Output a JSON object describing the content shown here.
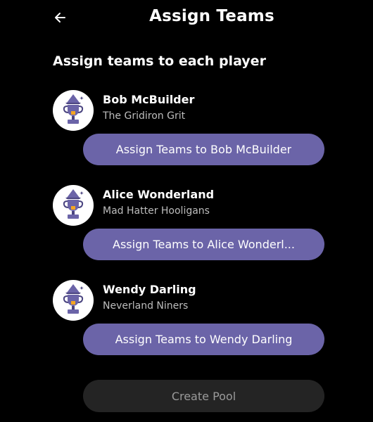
{
  "header": {
    "title": "Assign Teams"
  },
  "subtitle": "Assign teams to each player",
  "players": [
    {
      "name": "Bob McBuilder",
      "team": "The Gridiron Grit",
      "button_label": "Assign Teams to Bob McBuilder"
    },
    {
      "name": "Alice Wonderland",
      "team": "Mad Hatter Hooligans",
      "button_label": "Assign Teams to Alice Wonderl..."
    },
    {
      "name": "Wendy Darling",
      "team": "Neverland Niners",
      "button_label": "Assign Teams to Wendy Darling"
    }
  ],
  "footer": {
    "create_label": "Create Pool"
  },
  "colors": {
    "accent": "#6b64a8",
    "background": "#000000",
    "disabled_button": "#242424"
  }
}
